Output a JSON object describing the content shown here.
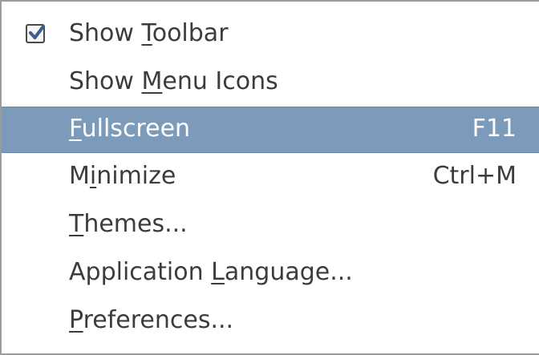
{
  "menu": {
    "items": [
      {
        "label_pre": "Show ",
        "label_mnemonic": "T",
        "label_post": "oolbar",
        "checked": true,
        "check_icon": "checkmark-icon"
      },
      {
        "label_pre": "Show ",
        "label_mnemonic": "M",
        "label_post": "enu Icons"
      },
      {
        "label_pre": "",
        "label_mnemonic": "F",
        "label_post": "ullscreen",
        "shortcut": "F11",
        "highlighted": true
      },
      {
        "label_pre": "M",
        "label_mnemonic": "i",
        "label_post": "nimize",
        "shortcut": "Ctrl+M"
      },
      {
        "label_pre": "",
        "label_mnemonic": "T",
        "label_post": "hemes...",
        "shortcut": ""
      },
      {
        "label_pre": "Application ",
        "label_mnemonic": "L",
        "label_post": "anguage...",
        "shortcut": ""
      },
      {
        "label_pre": "",
        "label_mnemonic": "P",
        "label_post": "references...",
        "shortcut": ""
      }
    ]
  },
  "colors": {
    "highlight_background": "#7c9ab9",
    "text": "#3c3c3c",
    "highlight_text": "#ffffff"
  }
}
